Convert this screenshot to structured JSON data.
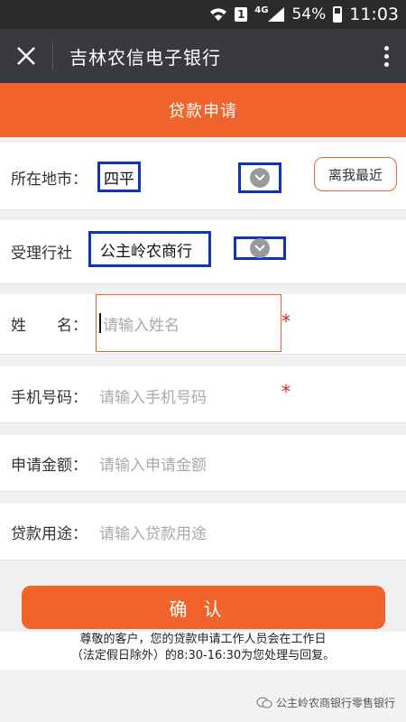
{
  "status_bar": {
    "sim_label": "1",
    "network": "4G",
    "battery": "54%",
    "time": "11:03"
  },
  "title_bar": {
    "close_icon": "close-x-icon",
    "title": "吉林农信电子银行",
    "more_icon": "more-vertical-icon"
  },
  "page_header": {
    "title": "贷款申请"
  },
  "form": {
    "location": {
      "label": "所在地市：",
      "value": "四平",
      "nearest_button": "离我最近"
    },
    "branch": {
      "label": "受理行社",
      "value": "公主岭农商行"
    },
    "name": {
      "label": "姓　　名：",
      "placeholder": "请输入姓名",
      "required": "*"
    },
    "phone": {
      "label": "手机号码：",
      "placeholder": "请输入手机号码",
      "required": "*"
    },
    "amount": {
      "label": "申请金额：",
      "placeholder": "请输入申请金额"
    },
    "purpose": {
      "label": "贷款用途：",
      "placeholder": "请输入贷款用途"
    }
  },
  "confirm_button": "确认",
  "notice": {
    "line1": "尊敬的客户，您的贷款申请工作人员会在工作日",
    "line2": "（法定假日除外）的8:30-16:30为您处理与回复。"
  },
  "watermark": "公主岭农商银行零售银行",
  "colors": {
    "accent": "#f0632a",
    "titlebar": "#393a3f",
    "highlight_box": "#1034b8",
    "required": "#e02020"
  }
}
